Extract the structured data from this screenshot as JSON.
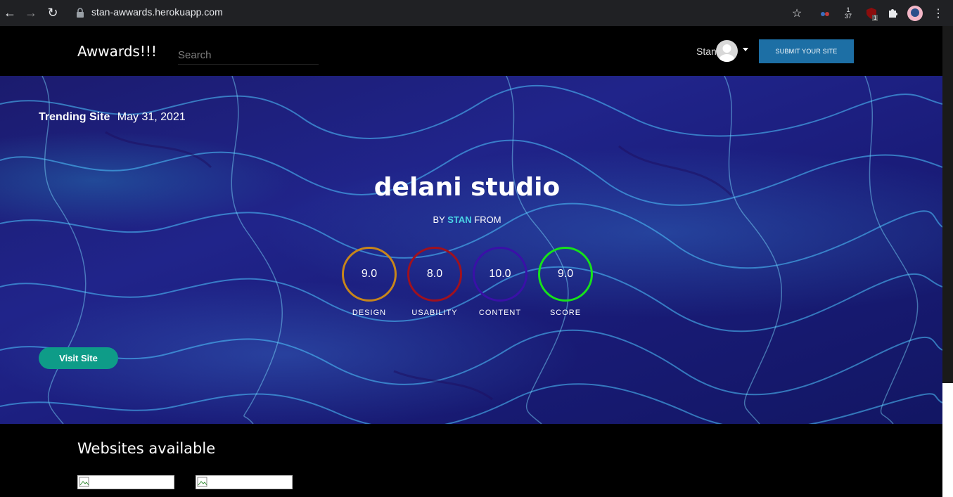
{
  "browser": {
    "url": "stan-awwards.herokuapp.com",
    "icons": [
      "back-arrow-icon",
      "forward-arrow-icon",
      "reload-icon",
      "lock-icon",
      "star-icon",
      "extension-icon",
      "menu-icon"
    ],
    "ext_badge_1": "1",
    "ext_badge_2": "37",
    "ext_badge_3": "1"
  },
  "header": {
    "brand": "Awwards!!!",
    "search_placeholder": "Search",
    "user_name": "Stan",
    "submit_label": "SUBMIT YOUR SITE",
    "submit_color": "#1d6fa5"
  },
  "hero": {
    "trending_label": "Trending Site",
    "date": "May 31, 2021",
    "site_title": "delani studio",
    "by_prefix": "BY",
    "author": "STAN",
    "from_label": "FROM",
    "scores": [
      {
        "value": "9.0",
        "label": "DESIGN",
        "color": "#c8861a"
      },
      {
        "value": "8.0",
        "label": "USABILITY",
        "color": "#a0111e"
      },
      {
        "value": "10.0",
        "label": "CONTENT",
        "color": "#3a10a8"
      },
      {
        "value": "9.0",
        "label": "SCORE",
        "color": "#16e31a"
      }
    ],
    "visit_label": "Visit Site",
    "visit_color": "#0e9c88"
  },
  "main": {
    "section_title": "Websites available"
  }
}
